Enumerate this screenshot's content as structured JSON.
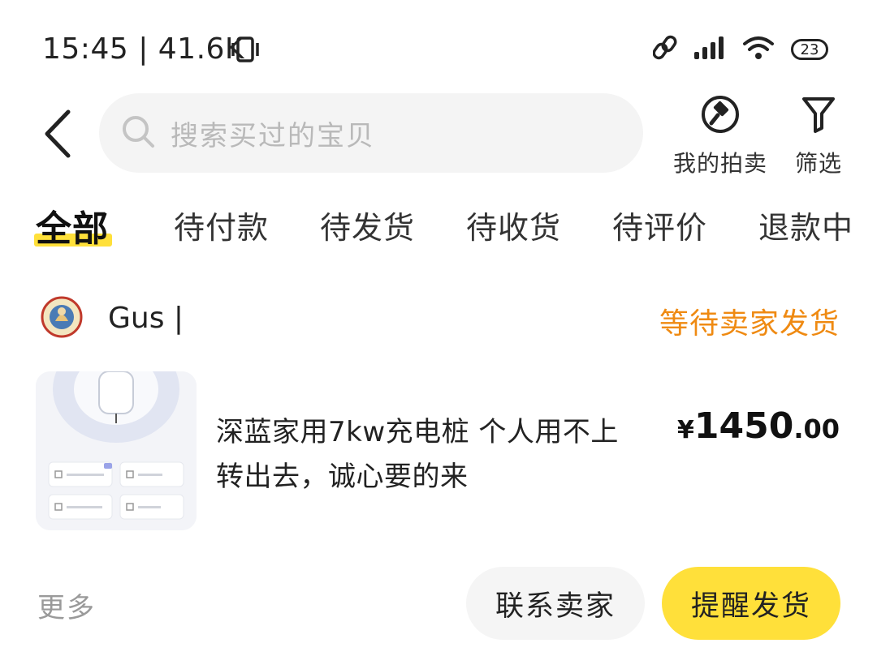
{
  "status_bar": {
    "time": "15:45 | 41.6K",
    "battery": "23"
  },
  "header": {
    "search_placeholder": "搜索买过的宝贝",
    "auction_label": "我的拍卖",
    "filter_label": "筛选"
  },
  "tabs": [
    {
      "label": "全部",
      "active": true
    },
    {
      "label": "待付款"
    },
    {
      "label": "待发货"
    },
    {
      "label": "待收货"
    },
    {
      "label": "待评价"
    },
    {
      "label": "退款中"
    }
  ],
  "order": {
    "shop_name": "Gus |",
    "status": "等待卖家发货",
    "product_title": "深蓝家用7kw充电桩  个人用不上转出去，诚心要的来",
    "price_currency": "¥",
    "price_integer": "1450",
    "price_decimal": ".00",
    "more_label": "更多",
    "contact_seller_label": "联系卖家",
    "remind_ship_label": "提醒发货"
  },
  "colors": {
    "accent_yellow": "#ffe03a",
    "status_orange": "#ef8a12",
    "muted_gray": "#9a9a9a"
  }
}
